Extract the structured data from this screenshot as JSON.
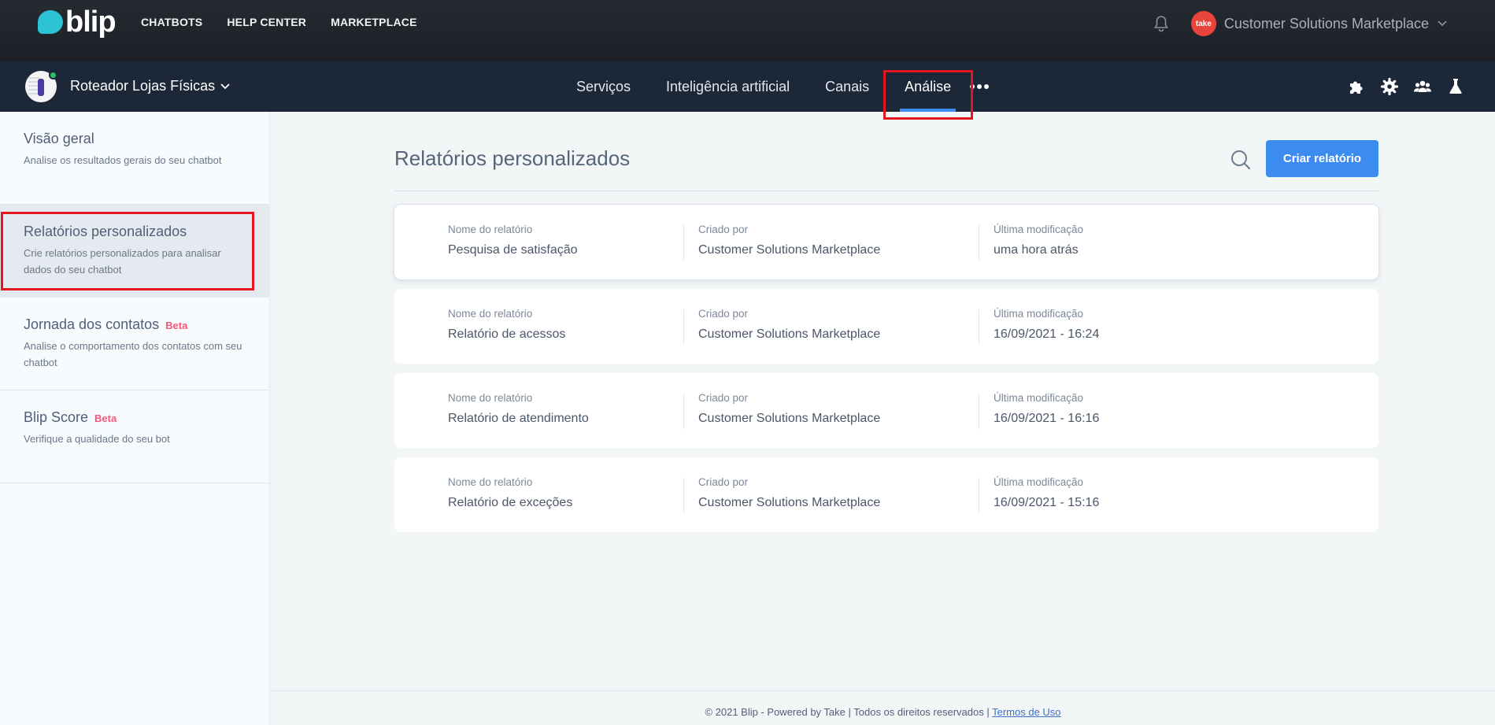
{
  "topbar": {
    "logo_text": "blip",
    "nav": [
      "CHATBOTS",
      "HELP CENTER",
      "MARKETPLACE"
    ],
    "org_avatar_text": "take",
    "org_name": "Customer Solutions Marketplace"
  },
  "botbar": {
    "bot_name": "Roteador Lojas Físicas",
    "nav": [
      "Serviços",
      "Inteligência artificial",
      "Canais",
      "Análise"
    ],
    "active_tab": "Análise"
  },
  "sidebar": {
    "items": [
      {
        "title": "Visão geral",
        "beta": "",
        "desc": "Analise os resultados gerais do seu chatbot"
      },
      {
        "title": "Relatórios personalizados",
        "beta": "",
        "desc": "Crie relatórios personalizados para analisar dados do seu chatbot"
      },
      {
        "title": "Jornada dos contatos",
        "beta": "Beta",
        "desc": "Analise o comportamento dos contatos com seu chatbot"
      },
      {
        "title": "Blip Score",
        "beta": "Beta",
        "desc": "Verifique a qualidade do seu bot"
      }
    ]
  },
  "main": {
    "title": "Relatórios personalizados",
    "create_button": "Criar relatório",
    "columns": [
      "Nome do relatório",
      "Criado por",
      "Última modificação"
    ],
    "reports": [
      {
        "name": "Pesquisa de satisfação",
        "created_by": "Customer Solutions Marketplace",
        "modified": "uma hora atrás"
      },
      {
        "name": "Relatório de acessos",
        "created_by": "Customer Solutions Marketplace",
        "modified": "16/09/2021 - 16:24"
      },
      {
        "name": "Relatório de atendimento",
        "created_by": "Customer Solutions Marketplace",
        "modified": "16/09/2021 - 16:16"
      },
      {
        "name": "Relatório de exceções",
        "created_by": "Customer Solutions Marketplace",
        "modified": "16/09/2021 - 15:16"
      }
    ]
  },
  "footer": {
    "text": "© 2021 Blip - Powered by Take | Todos os direitos reservados | ",
    "link": "Termos de Uso"
  },
  "colors": {
    "accent": "#3c8bf1",
    "highlight": "#e2161e",
    "beta": "#f6577c",
    "logo": "#2cc3d5"
  }
}
